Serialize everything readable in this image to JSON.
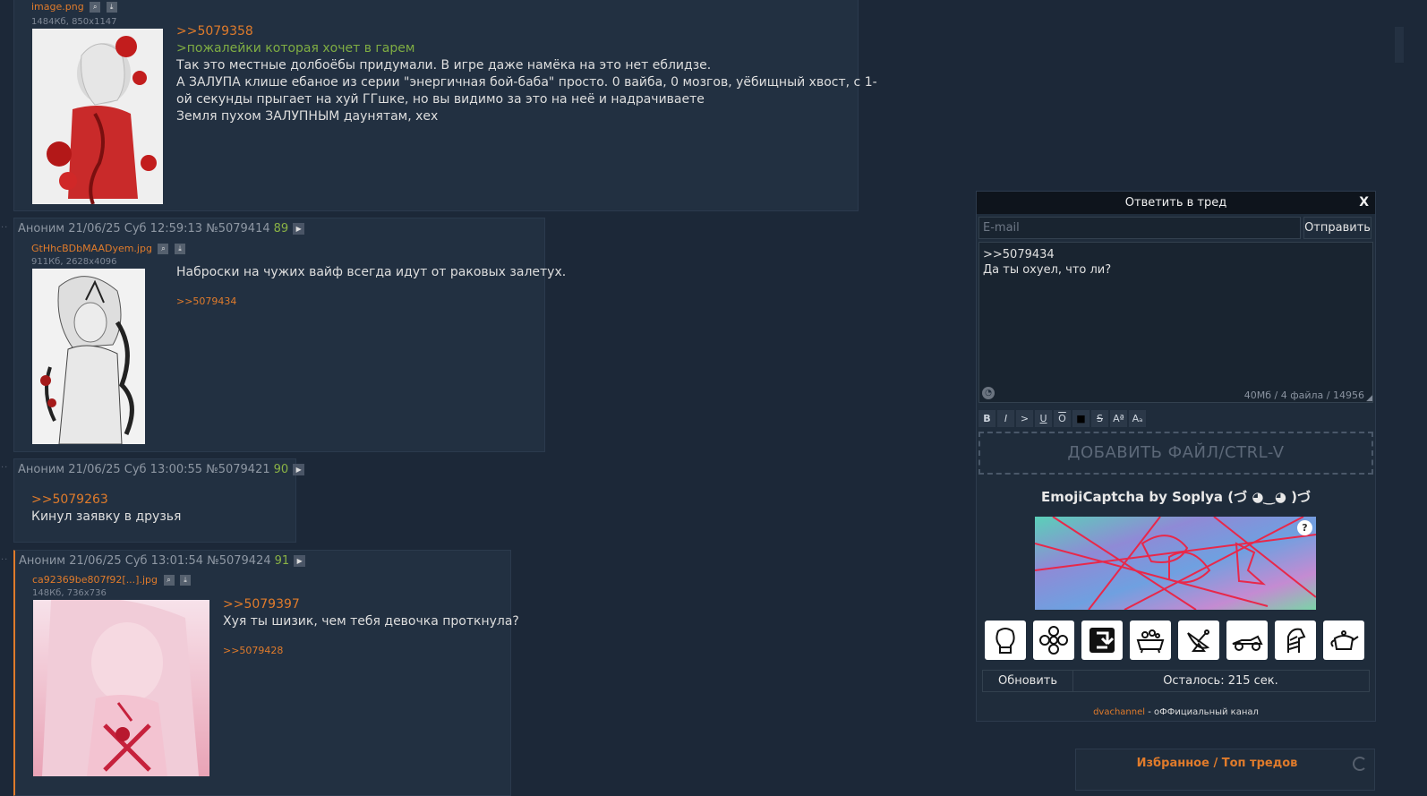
{
  "posts": [
    {
      "file": {
        "name": "image.png",
        "meta": "1484Кб, 850x1147"
      },
      "reply_to": ">>5079358",
      "lines": [
        {
          "text": ">пожалейки которая хочет в гарем",
          "style": "greentext"
        },
        {
          "text": "Так это местные долбоёбы придумали. В игре даже намёка на это нет еблидзе.",
          "style": "normal"
        },
        {
          "text": "А ЗАЛУПА клише ебаное из серии \"энергичная бой-баба\" просто. 0 вайба, 0 мозгов, уёбищный хвост, с 1-",
          "style": "normal"
        },
        {
          "text": "ой секунды прыгает на хуй ГГшке, но вы видимо за это на неё и надрачиваете",
          "style": "normal"
        },
        {
          "text": "Земля пухом ЗАЛУПНЫМ даунятам, хех",
          "style": "normal"
        }
      ]
    },
    {
      "header": "Аноним 21/06/25 Суб 12:59:13 №5079414",
      "num": "89",
      "file": {
        "name": "GtHhcBDbMAADyem.jpg",
        "meta": "911Кб, 2628x4096"
      },
      "text": "Наброски на чужих вайф всегда идут от раковых залетух.",
      "backlink": ">>5079434"
    },
    {
      "header": "Аноним 21/06/25 Суб 13:00:55 №5079421",
      "num": "90",
      "reply_to": ">>5079263",
      "text": "Кинул заявку в друзья"
    },
    {
      "header": "Аноним 21/06/25 Суб 13:01:54 №5079424",
      "num": "91",
      "file": {
        "name": "ca92369be807f92[...].jpg",
        "meta": "148Кб, 736x736"
      },
      "reply_to": ">>5079397",
      "text": "Хуя ты шизик, чем тебя девочка проткнула?",
      "backlink": ">>5079428"
    }
  ],
  "icons": {
    "search": "magnifier-icon",
    "download": "download-icon",
    "play": "play-icon"
  },
  "reply_form": {
    "title": "Ответить в тред",
    "close": "X",
    "email_placeholder": "E-mail",
    "send": "Отправить",
    "comment_line1": ">>5079434",
    "comment_line2": "Да ты охуел, что ли?",
    "limits": "40Мб / 4 файла / 14956",
    "markup": [
      "B",
      "I",
      ">",
      "U",
      "O",
      "■",
      "S",
      "Aª",
      "Aₐ"
    ],
    "dropzone": "ДОБАВИТЬ ФАЙЛ/CTRL-V",
    "captcha_title": "EmojiCaptcha by Soplya (づ ◕‿◕ )づ",
    "captcha_help": "?",
    "emoji_icons": [
      "boxing-glove",
      "flower",
      "arrow-return",
      "bathtub",
      "satellite-dish",
      "racing-car",
      "zebra",
      "teapot"
    ],
    "refresh": "Обновить",
    "timer": "Осталось: 215 сек.",
    "channel_link": "dvachannel",
    "channel_suffix": " - оФФициальный канал"
  },
  "favorites": "Избранное / Топ тредов",
  "colors": {
    "background": "#1c2838",
    "post": "#223041",
    "accent": "#e07b2b",
    "greentext": "#7fad43"
  }
}
